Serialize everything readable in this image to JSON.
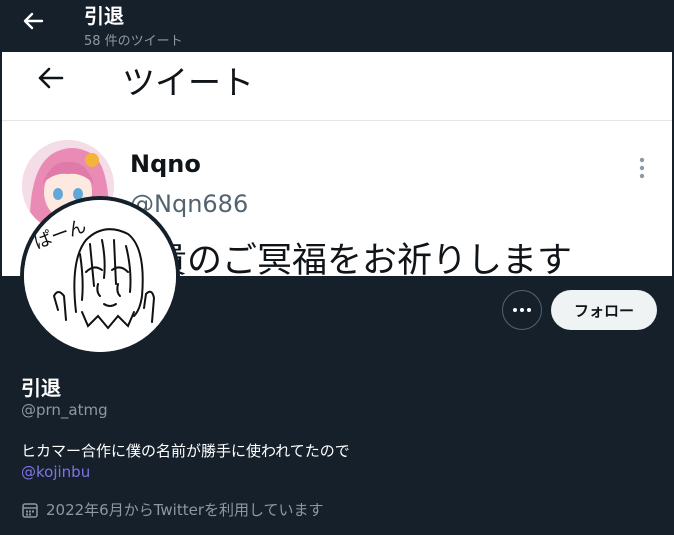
{
  "header": {
    "title": "引退",
    "tweet_count": "58 件のツイート"
  },
  "banner": {
    "heading": "ツイート",
    "tweet_name": "Nqno",
    "tweet_handle": "@Nqn686",
    "tweet_text": "ご冥福をお祈りします",
    "tweet_text_full": "貴のご冥福をお祈りします"
  },
  "profile": {
    "name": "引退",
    "handle": "@prn_atmg",
    "bio": "ヒカマー合作に僕の名前が勝手に使われてたので",
    "link": "@kojinbu",
    "joined": "2022年6月からTwitterを利用しています",
    "avatar_text": "ぱーん"
  },
  "actions": {
    "follow_label": "フォロー",
    "more_icon": "more-icon"
  },
  "colors": {
    "background": "#15202b",
    "link": "#7f73e6",
    "muted": "#8b98a5"
  }
}
